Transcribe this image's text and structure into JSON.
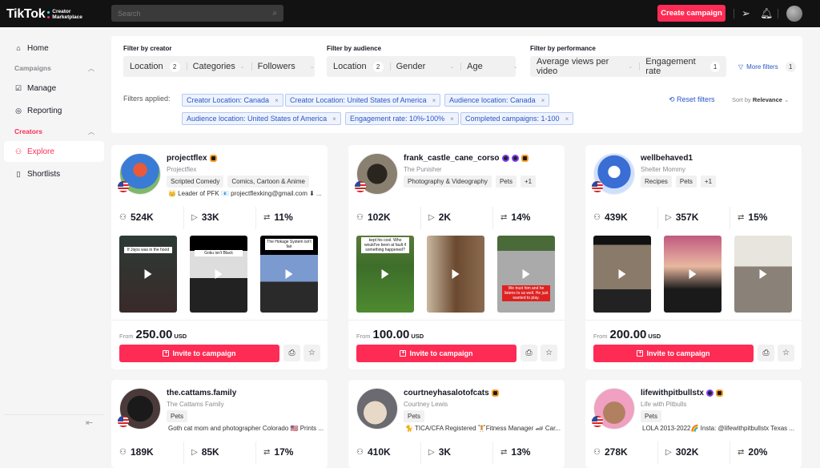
{
  "header": {
    "logo_text": "TikTok",
    "logo_sub1": "Creator",
    "logo_sub2": "Marketplace",
    "search_placeholder": "Search",
    "create_campaign": "Create campaign"
  },
  "sidebar": {
    "home": "Home",
    "campaigns_section": "Campaigns",
    "manage": "Manage",
    "reporting": "Reporting",
    "creators_section": "Creators",
    "explore": "Explore",
    "shortlists": "Shortlists"
  },
  "filters": {
    "creator": {
      "label": "Filter by creator",
      "location": "Location",
      "location_count": "2",
      "categories": "Categories",
      "followers": "Followers"
    },
    "audience": {
      "label": "Filter by audience",
      "location": "Location",
      "location_count": "2",
      "gender": "Gender",
      "age": "Age"
    },
    "performance": {
      "label": "Filter by performance",
      "avg_views": "Average views per video",
      "engagement": "Engagement rate",
      "engagement_count": "1"
    },
    "more_filters": "More filters",
    "more_filters_count": "1",
    "applied_label": "Filters applied:",
    "chips": [
      "Creator Location: Canada",
      "Creator Location: United States of America",
      "Audience location: Canada",
      "Audience location: United States of America",
      "Engagement rate: 10%-100%",
      "Completed campaigns: 1-100"
    ],
    "reset": "Reset filters",
    "sort_prefix": "Sort by",
    "sort_value": "Relevance"
  },
  "invite_label": "Invite to campaign",
  "from_label": "From",
  "currency": "USD",
  "creators": [
    {
      "username": "projectflex",
      "display": "Projectflex",
      "tags": [
        "Scripted Comedy",
        "Comics, Cartoon & Anime"
      ],
      "bio": "👑 Leader of PFK 📧 projectflexking@gmail.com ⬇ ...",
      "followers": "524K",
      "views": "33K",
      "engagement": "11%",
      "price": "250.00",
      "video_captions": [
        "If Jojos was in the hood",
        "Goku isn't Black",
        "The Hokage System isn't fair"
      ]
    },
    {
      "username": "frank_castle_cane_corso",
      "display": "The Punisher",
      "tags": [
        "Photography & Videography",
        "Pets",
        "+1"
      ],
      "bio": "",
      "followers": "102K",
      "views": "2K",
      "engagement": "14%",
      "price": "100.00",
      "video_captions": [
        "kept his cool. Who would've been at fault if something happened?",
        "",
        "We trust him and he listens to us well. He just wanted to play."
      ]
    },
    {
      "username": "wellbehaved1",
      "display": "Shelter Mommy",
      "tags": [
        "Recipes",
        "Pets",
        "+1"
      ],
      "bio": "",
      "followers": "439K",
      "views": "357K",
      "engagement": "15%",
      "price": "200.00",
      "video_captions": [
        "",
        "",
        ""
      ]
    },
    {
      "username": "the.cattams.family",
      "display": "The Cattams Family",
      "tags": [
        "Pets"
      ],
      "bio": "Goth cat mom and photographer Colorado 🇺🇸 Prints ...",
      "followers": "189K",
      "views": "85K",
      "engagement": "17%"
    },
    {
      "username": "courtneyhasalotofcats",
      "display": "Courtney Lewis",
      "tags": [
        "Pets"
      ],
      "bio": "🐈 TICA/CFA Registered 🏋Fitness Manager 🏎 Car...",
      "followers": "410K",
      "views": "3K",
      "engagement": "13%"
    },
    {
      "username": "lifewithpitbullstx",
      "display": "Life with Pitbulls",
      "tags": [
        "Pets"
      ],
      "bio": "LOLA 2013-2022🌈 Insta: @lifewithpitbullstx Texas ...",
      "followers": "278K",
      "views": "302K",
      "engagement": "20%"
    }
  ]
}
